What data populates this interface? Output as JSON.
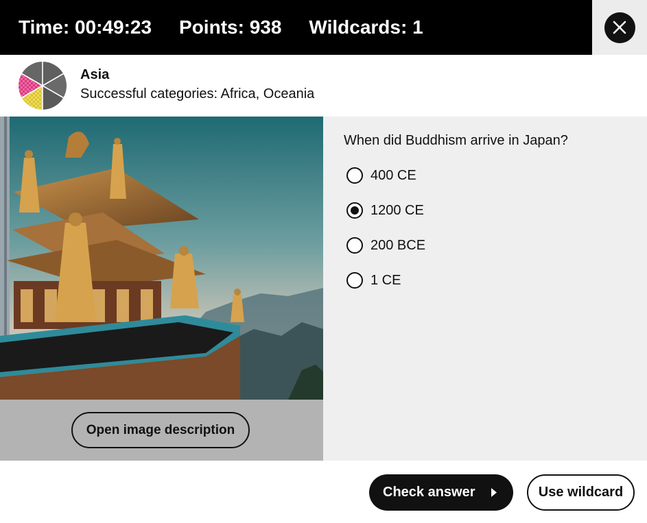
{
  "header": {
    "time_label": "Time: 00:49:23",
    "points_label": "Points: 938",
    "wildcards_label": "Wildcards: 1",
    "close_icon": "close-icon"
  },
  "category": {
    "name": "Asia",
    "successful": "Successful categories: Africa, Oceania",
    "wheel_icon": "category-wheel-icon"
  },
  "image": {
    "alt": "Golden-roofed Buddhist temple overlooking misty mountains",
    "description_button": "Open image description"
  },
  "quiz": {
    "question": "When did Buddhism arrive in Japan?",
    "options": [
      {
        "label": "400 CE",
        "selected": false
      },
      {
        "label": "1200 CE",
        "selected": true
      },
      {
        "label": "200 BCE",
        "selected": false
      },
      {
        "label": "1 CE",
        "selected": false
      }
    ]
  },
  "actions": {
    "check_answer": "Check answer",
    "use_wildcard": "Use wildcard"
  },
  "colors": {
    "topbar": "#000000",
    "panel_gray": "#efefef",
    "image_footer": "#b3b3b3",
    "wheel_pink": "#e8508f",
    "wheel_yellow": "#e8d44a",
    "wheel_gray": "#5a5a5a"
  }
}
